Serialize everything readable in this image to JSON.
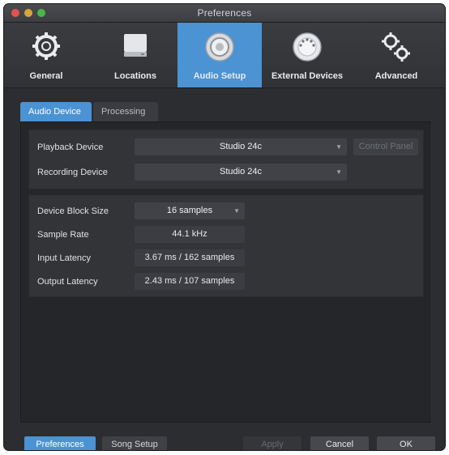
{
  "window": {
    "title": "Preferences"
  },
  "toolbar": {
    "items": [
      {
        "label": "General",
        "icon": "gear-icon"
      },
      {
        "label": "Locations",
        "icon": "drive-icon"
      },
      {
        "label": "Audio Setup",
        "icon": "speaker-icon",
        "active": true
      },
      {
        "label": "External Devices",
        "icon": "midi-port-icon"
      },
      {
        "label": "Advanced",
        "icon": "gears-icon"
      }
    ]
  },
  "tabs": {
    "audio_device": "Audio Device",
    "processing": "Processing"
  },
  "device": {
    "playback_label": "Playback Device",
    "playback_value": "Studio 24c",
    "recording_label": "Recording Device",
    "recording_value": "Studio 24c",
    "control_panel_label": "Control Panel"
  },
  "settings": {
    "block_size_label": "Device Block Size",
    "block_size_value": "16 samples",
    "sample_rate_label": "Sample Rate",
    "sample_rate_value": "44.1 kHz",
    "input_latency_label": "Input Latency",
    "input_latency_value": "3.67 ms / 162 samples",
    "output_latency_label": "Output Latency",
    "output_latency_value": "2.43 ms / 107 samples"
  },
  "footer": {
    "preferences": "Preferences",
    "song_setup": "Song Setup",
    "apply": "Apply",
    "cancel": "Cancel",
    "ok": "OK"
  },
  "colors": {
    "accent": "#4b93d3",
    "background": "#2b2d30"
  }
}
